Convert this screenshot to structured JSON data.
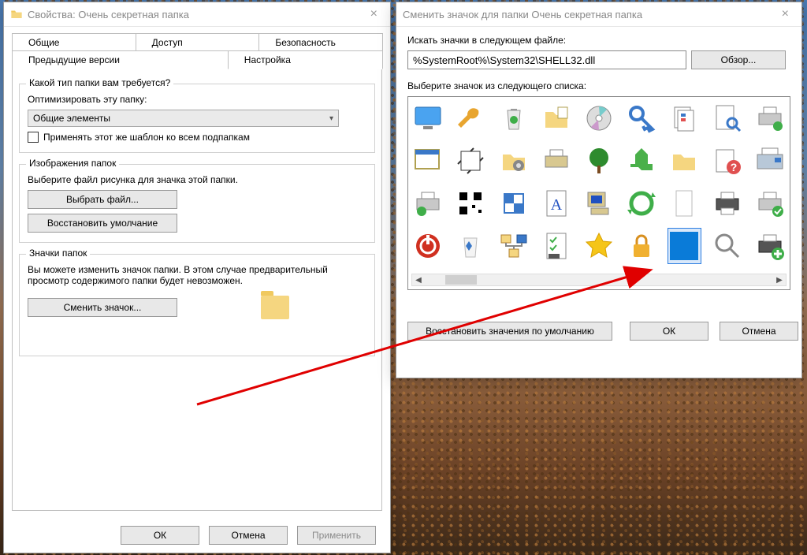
{
  "props": {
    "title": "Свойства: Очень секретная папка",
    "tabs": {
      "general": "Общие",
      "sharing": "Доступ",
      "security": "Безопасность",
      "prev": "Предыдущие версии",
      "customize": "Настройка"
    },
    "typeGroup": {
      "legend": "Какой тип папки вам требуется?",
      "optimize": "Оптимизировать эту папку:",
      "comboValue": "Общие элементы",
      "applyTemplate": "Применять этот же шаблон ко всем подпапкам"
    },
    "imgGroup": {
      "legend": "Изображения папок",
      "desc": "Выберите файл рисунка для значка этой папки.",
      "choose": "Выбрать файл...",
      "restore": "Восстановить умолчание"
    },
    "iconGroup": {
      "legend": "Значки папок",
      "desc": "Вы можете изменить значок папки. В этом случае предварительный просмотр содержимого папки будет невозможен.",
      "change": "Сменить значок..."
    },
    "actions": {
      "ok": "ОК",
      "cancel": "Отмена",
      "apply": "Применить"
    }
  },
  "iconDlg": {
    "title": "Сменить значок для папки Очень секретная папка",
    "searchLabel": "Искать значки в следующем файле:",
    "path": "%SystemRoot%\\System32\\SHELL32.dll",
    "browse": "Обзор...",
    "selectLabel": "Выберите значок из следующего списка:",
    "restore": "Восстановить значения по умолчанию",
    "ok": "ОК",
    "cancel": "Отмена"
  }
}
